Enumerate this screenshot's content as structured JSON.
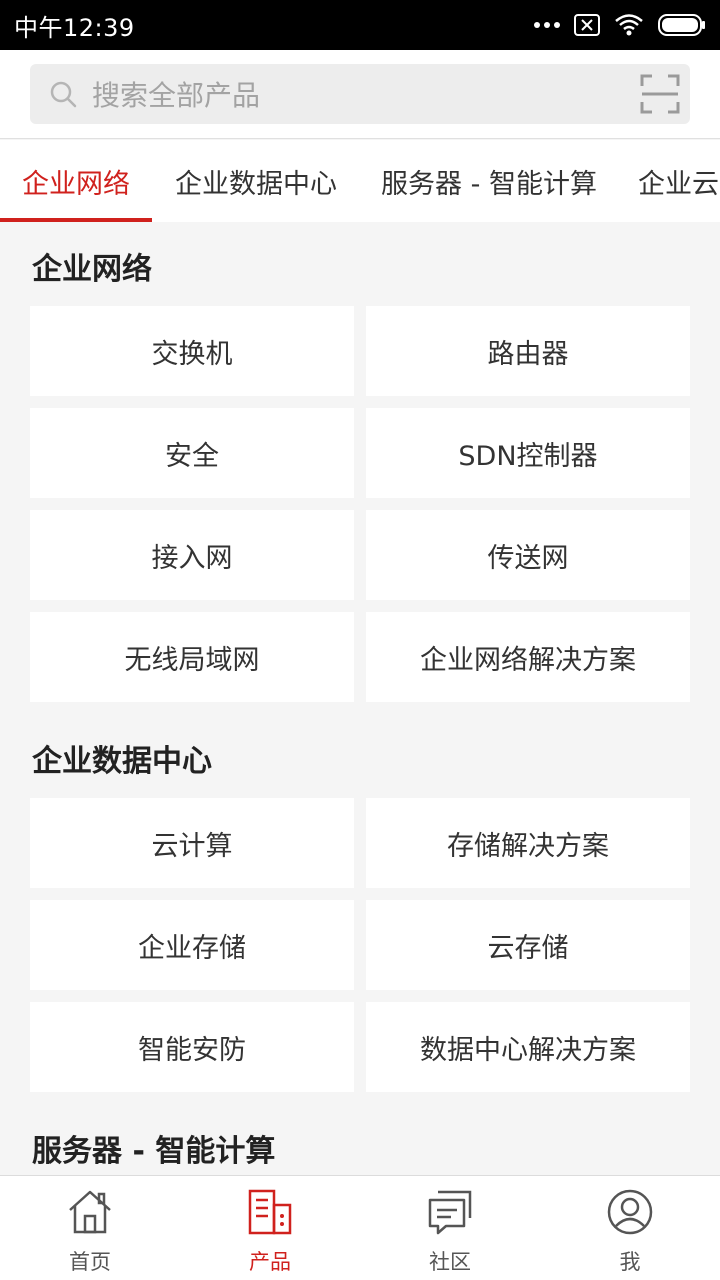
{
  "status_bar": {
    "time": "中午12:39"
  },
  "search": {
    "placeholder": "搜索全部产品"
  },
  "tabs": [
    {
      "label": "企业网络",
      "active": true
    },
    {
      "label": "企业数据中心",
      "active": false
    },
    {
      "label": "服务器 - 智能计算",
      "active": false
    },
    {
      "label": "企业云",
      "active": false
    }
  ],
  "sections": [
    {
      "title": "企业网络",
      "items": [
        "交换机",
        "路由器",
        "安全",
        "SDN控制器",
        "接入网",
        "传送网",
        "无线局域网",
        "企业网络解决方案"
      ]
    },
    {
      "title": "企业数据中心",
      "items": [
        "云计算",
        "存储解决方案",
        "企业存储",
        "云存储",
        "智能安防",
        "数据中心解决方案"
      ]
    },
    {
      "title": "服务器 - 智能计算",
      "items": []
    }
  ],
  "bottom_nav": [
    {
      "label": "首页",
      "icon": "home-icon"
    },
    {
      "label": "产品",
      "icon": "products-icon"
    },
    {
      "label": "社区",
      "icon": "community-icon"
    },
    {
      "label": "我",
      "icon": "profile-icon"
    }
  ],
  "colors": {
    "accent": "#d0211d",
    "background": "#f5f5f5",
    "card": "#ffffff",
    "status_bar": "#000000"
  }
}
